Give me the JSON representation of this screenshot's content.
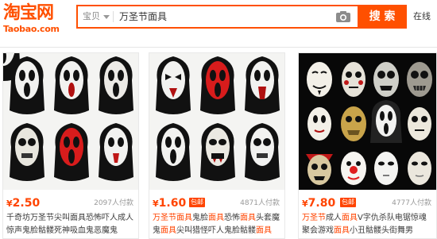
{
  "header": {
    "logo_cn": "淘宝网",
    "logo_en": "Taobao.com",
    "search_type": "宝贝",
    "search_query": "万圣节面具",
    "search_button": "搜 索",
    "nav_right": "在线"
  },
  "colors": {
    "brand": "#ff5000",
    "price": "#ff4400"
  },
  "products": [
    {
      "currency": "¥",
      "price": "2.50",
      "badge": "",
      "sales": "2097人付款",
      "title": [
        {
          "t": "千奇坊万圣节尖叫面具恐怖吓人成人",
          "h": false
        },
        {
          "t": "惊声鬼脸骷髅死神吸血鬼恶魔鬼",
          "h": false
        }
      ]
    },
    {
      "currency": "¥",
      "price": "1.60",
      "badge": "包邮",
      "sales": "4871人付款",
      "title": [
        {
          "t": "万圣节面具",
          "h": true
        },
        {
          "t": "鬼脸",
          "h": false
        },
        {
          "t": "面具",
          "h": true
        },
        {
          "t": "恐怖",
          "h": false
        },
        {
          "t": "面具",
          "h": true
        },
        {
          "t": "头套魔鬼",
          "h": false
        },
        {
          "t": "面具",
          "h": true
        },
        {
          "t": "尖叫猎怪吓人鬼脸骷髅",
          "h": false
        },
        {
          "t": "面具",
          "h": true
        }
      ]
    },
    {
      "currency": "¥",
      "price": "7.80",
      "badge": "包邮",
      "sales": "4777人付款",
      "title": [
        {
          "t": "万圣节",
          "h": true
        },
        {
          "t": "成人",
          "h": false
        },
        {
          "t": "面具",
          "h": true
        },
        {
          "t": "V字仇杀队电锯惊魂聚",
          "h": false
        },
        {
          "t": "会游戏",
          "h": false
        },
        {
          "t": "面具",
          "h": true
        },
        {
          "t": "小丑骷髅头街舞男",
          "h": false
        }
      ]
    }
  ]
}
